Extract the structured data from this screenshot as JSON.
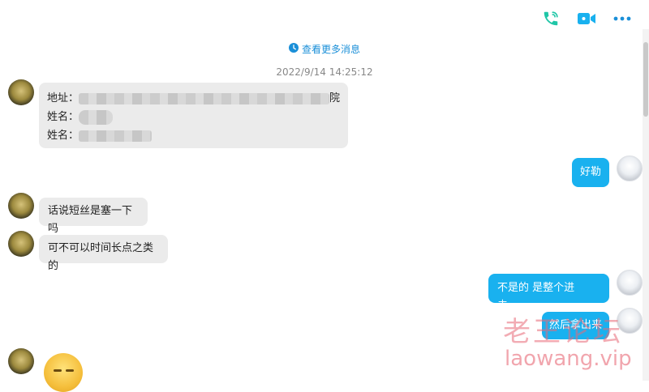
{
  "header": {
    "phone_icon": "phone-icon",
    "video_icon": "video-call-icon",
    "more_icon": "more-options-icon",
    "accent_color": "#1fc6a7"
  },
  "chat": {
    "view_more_label": "查看更多消息",
    "timestamp": "2022/9/14 14:25:12",
    "messages": [
      {
        "side": "left",
        "lines": [
          {
            "label": "地址：",
            "value_visible_tail": "院"
          },
          {
            "label": "姓名：",
            "value_visible_tail": ""
          },
          {
            "label": "姓名：",
            "value_visible_tail": ""
          }
        ]
      },
      {
        "side": "right",
        "text": "好勒"
      },
      {
        "side": "left",
        "text": "话说短丝是塞一下吗"
      },
      {
        "side": "left",
        "text": "可不可以时间长点之类的"
      },
      {
        "side": "right",
        "text": "不是的 是整个进去。。"
      },
      {
        "side": "right",
        "text": "然后拿出来"
      }
    ]
  },
  "watermark": {
    "title": "老王论坛",
    "domain": "laowang.vip"
  },
  "colors": {
    "bubble_left": "#ebebeb",
    "bubble_right": "#19b1ef",
    "link": "#1a8fd8",
    "watermark": "#e96a78"
  }
}
